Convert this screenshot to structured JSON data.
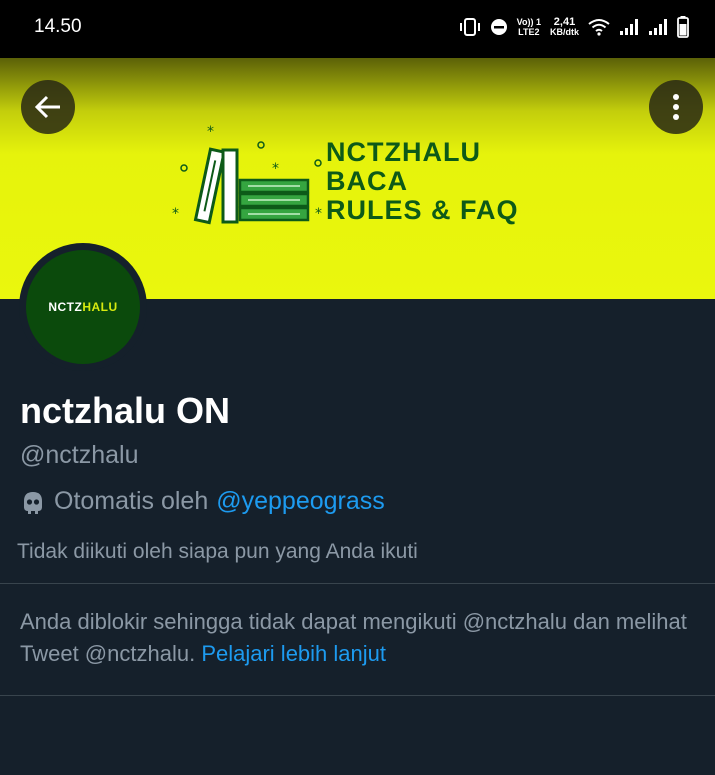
{
  "status_bar": {
    "time": "14.50",
    "network_top": "Vo)) 1",
    "network_bottom": "LTE2",
    "speed_value": "2,41",
    "speed_unit": "KB/dtk",
    "icons": [
      "vibrate-icon",
      "dnd-icon",
      "wifi-icon",
      "signal-icon",
      "signal-icon",
      "battery-icon"
    ]
  },
  "header": {
    "back_icon": "arrow-left-icon",
    "more_icon": "more-vertical-icon"
  },
  "banner": {
    "line1": "NCTZHALU",
    "line2": "BACA",
    "line3": "RULES & FAQ",
    "background_color": "#eaf70d",
    "text_color": "#0d5a18"
  },
  "avatar": {
    "text_a": "NCTZ",
    "text_b": "HALU",
    "background_color": "#0b4a0c"
  },
  "profile": {
    "name": "nctzhalu ON",
    "handle": "@nctzhalu",
    "automated_label": "Otomatis oleh",
    "automated_by": "@yeppeograss",
    "followed_by": "Tidak diikuti oleh siapa pun yang Anda ikuti"
  },
  "blocked_notice": {
    "text": "Anda diblokir sehingga tidak dapat mengikuti @nctzhalu dan melihat Tweet @nctzhalu.",
    "link": "Pelajari lebih lanjut"
  },
  "colors": {
    "background": "#15202b",
    "secondary_text": "#8b98a5",
    "link": "#1d9bf0"
  }
}
